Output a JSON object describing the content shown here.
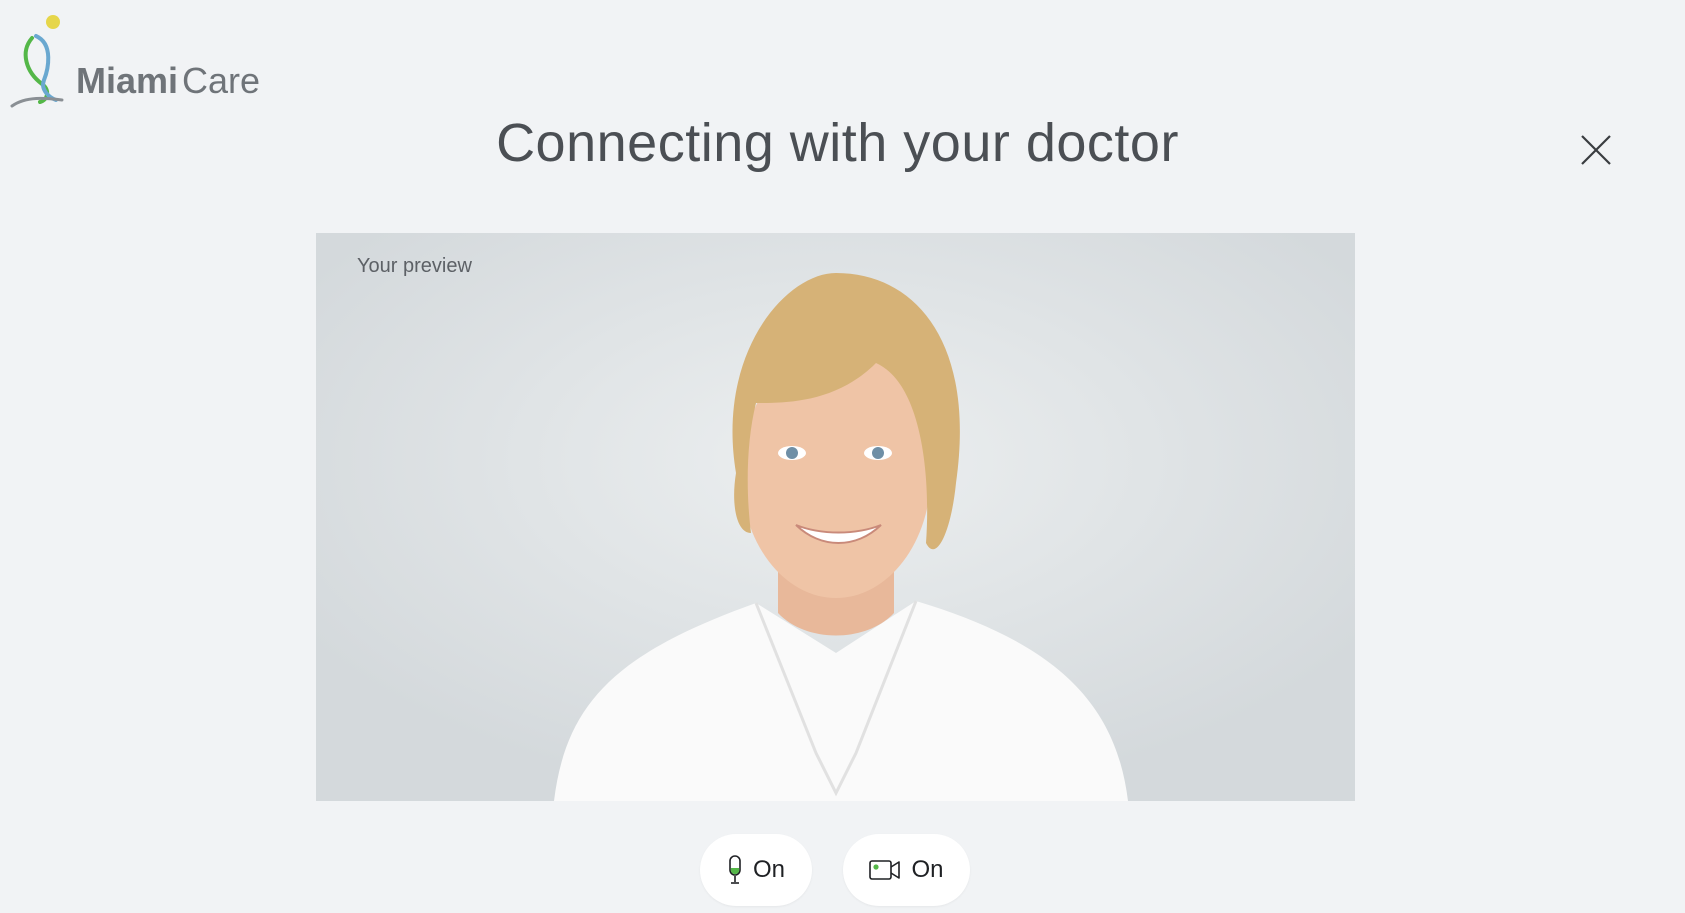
{
  "brand": {
    "name_bold": "Miami",
    "name_regular": "Care"
  },
  "header": {
    "title": "Connecting with your doctor"
  },
  "preview": {
    "label": "Your preview"
  },
  "controls": {
    "mic": {
      "label": "On",
      "icon": "microphone-icon",
      "state": "on"
    },
    "camera": {
      "label": "On",
      "icon": "video-camera-icon",
      "state": "on"
    }
  },
  "colors": {
    "background": "#f1f3f5",
    "accent_green": "#54b748",
    "logo_yellow": "#e6d64a",
    "logo_blue": "#6aa8d0"
  }
}
